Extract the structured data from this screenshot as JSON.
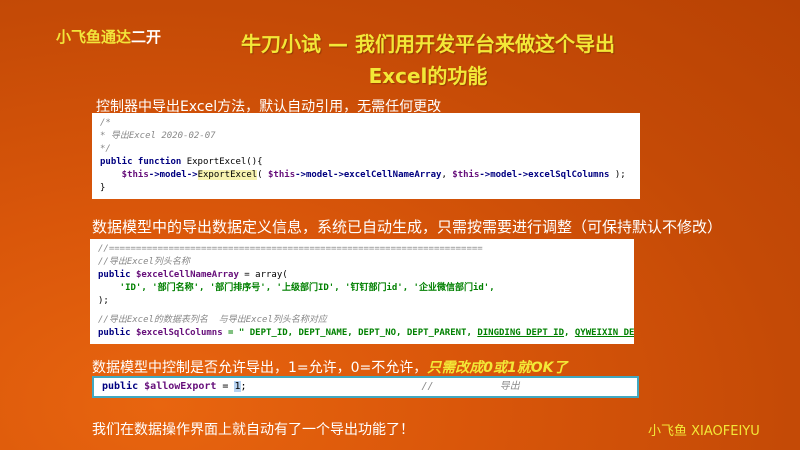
{
  "brand": {
    "part1": "小飞鱼通达",
    "part2": "二开"
  },
  "title": {
    "line1": "牛刀小试 — 我们用开发平台来做这个导出",
    "line2": "Excel的功能"
  },
  "captions": {
    "c1": "控制器中导出Excel方法，默认自动引用，无需任何更改",
    "c2": "数据模型中的导出数据定义信息，系统已自动生成，只需按需要进行调整（可保持默认不修改）",
    "c3": "数据模型中控制是否允许导出，1=允许，0=不允许，",
    "c3_highlight": "只需改成0或1就OK了",
    "c4": "我们在数据操作界面上就自动有了一个导出功能了！"
  },
  "author": "小飞鱼 XIAOFEIYU",
  "code1": {
    "l1": "/*",
    "l2": "* 导出Excel 2020-02-07",
    "l3": "*/",
    "l4_kw": "public function",
    "l4_rest": " ExportExcel(){",
    "l5_a": "    $this",
    "l5_b": "->model->",
    "l5_c": "ExportExcel",
    "l5_d": "( ",
    "l5_e": "$this",
    "l5_f": "->model->",
    "l5_g": "excelCellNameArray",
    "l5_h": ", ",
    "l5_i": "$this",
    "l5_j": "->model->",
    "l5_k": "excelSqlColumns",
    "l5_l": " );",
    "l6": "}"
  },
  "code2": {
    "l1": "//=====================================================================",
    "l2": "//导出Excel列头名称",
    "l3_kw": "public ",
    "l3_var": "$excelCellNameArray",
    "l3_rest": " = array(",
    "l4": "    'ID', '部门名称', '部门排序号', '上级部门ID', '钉钉部门id', '企业微信部门id',",
    "l5": ");",
    "l6": "//导出Excel的数据表列名  与导出Excel列头名称对应",
    "l7_kw": "public ",
    "l7_var": "$excelSqlColumns",
    "l7_a": " = \" DEPT_ID, DEPT_NAME, DEPT_NO, DEPT_PARENT, ",
    "l7_b": "DINGDING_DEPT_ID",
    "l7_c": ", ",
    "l7_d": "QYWEIXIN_DEPT_ID",
    "l7_e": "\";"
  },
  "code3": {
    "kw": "public ",
    "var": "$allowExport",
    "eq": " = ",
    "val": "1",
    "semi": ";",
    "comment": "//           导出"
  }
}
